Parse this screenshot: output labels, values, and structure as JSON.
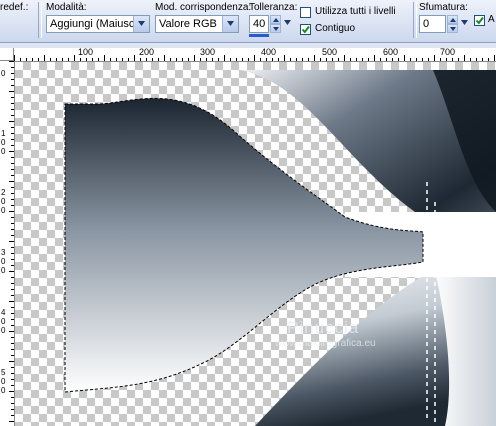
{
  "toolbar": {
    "cut_label": "redef.:",
    "modality": {
      "label": "Modalità:",
      "value": "Aggiungi (Maiusc)"
    },
    "match_mode": {
      "label": "Mod. corrispondenza:",
      "value": "Valore RGB"
    },
    "tolerance": {
      "label": "Tolleranza:",
      "value": "40"
    },
    "use_all_layers": {
      "label": "Utilizza tutti i livelli",
      "checked": false
    },
    "contiguous": {
      "label": "Contiguo",
      "checked": true
    },
    "feather": {
      "label": "Sfumatura:",
      "value": "0"
    },
    "antialias": {
      "label": "A",
      "checked": true
    }
  },
  "ruler": {
    "h_labels": [
      "100",
      "200",
      "300",
      "400",
      "500",
      "600",
      "700"
    ],
    "v_labels": [
      "0",
      "1",
      "0",
      "0",
      "2",
      "0",
      "0",
      "3",
      "0",
      "0",
      "4",
      "0",
      "0",
      "5",
      "0",
      "0"
    ]
  },
  "canvas": {
    "watermark_name": "Pinuccia",
    "watermark_url": "www.maidiregrafica.eu",
    "colors": {
      "dark": "#1b2530",
      "mid": "#5f6e7e",
      "light": "#ffffff",
      "checker": "#c8c8c8"
    }
  }
}
